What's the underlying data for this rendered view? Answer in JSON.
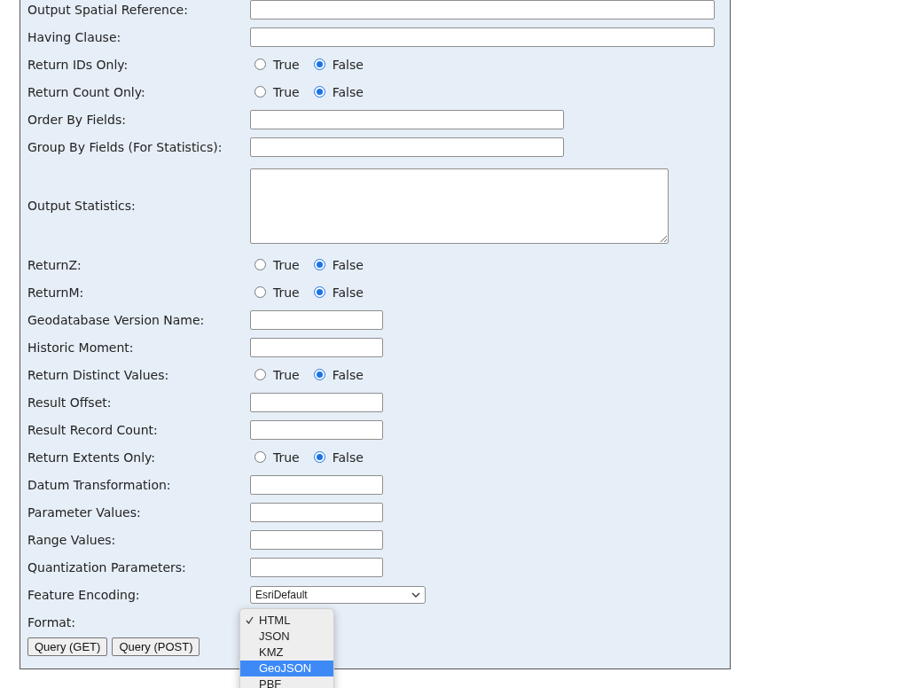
{
  "rows": [
    {
      "label": "Output Spatial Reference:",
      "kind": "text"
    },
    {
      "label": "Having Clause:",
      "kind": "text"
    },
    {
      "label": "Return IDs Only:",
      "kind": "radio",
      "options": [
        {
          "label": "True",
          "selected": false
        },
        {
          "label": "False",
          "selected": true
        }
      ]
    },
    {
      "label": "Return Count Only:",
      "kind": "radio",
      "options": [
        {
          "label": "True",
          "selected": false
        },
        {
          "label": "False",
          "selected": true
        }
      ]
    },
    {
      "label": "Order By Fields:",
      "kind": "text"
    },
    {
      "label": "Group By Fields (For Statistics):",
      "kind": "text"
    },
    {
      "label": "Output Statistics:",
      "kind": "textarea"
    },
    {
      "label": "ReturnZ:",
      "kind": "radio",
      "options": [
        {
          "label": "True",
          "selected": false
        },
        {
          "label": "False",
          "selected": true
        }
      ]
    },
    {
      "label": "ReturnM:",
      "kind": "radio",
      "options": [
        {
          "label": "True",
          "selected": false
        },
        {
          "label": "False",
          "selected": true
        }
      ]
    },
    {
      "label": "Geodatabase Version Name:",
      "kind": "text"
    },
    {
      "label": "Historic Moment:",
      "kind": "text"
    },
    {
      "label": "Return Distinct Values:",
      "kind": "radio",
      "options": [
        {
          "label": "True",
          "selected": false
        },
        {
          "label": "False",
          "selected": true
        }
      ]
    },
    {
      "label": "Result Offset:",
      "kind": "text"
    },
    {
      "label": "Result Record Count:",
      "kind": "text"
    },
    {
      "label": "Return Extents Only:",
      "kind": "radio",
      "options": [
        {
          "label": "True",
          "selected": false
        },
        {
          "label": "False",
          "selected": true
        }
      ]
    },
    {
      "label": "Datum Transformation:",
      "kind": "text"
    },
    {
      "label": "Parameter Values:",
      "kind": "text"
    },
    {
      "label": "Range Values:",
      "kind": "text"
    },
    {
      "label": "Quantization Parameters:",
      "kind": "text"
    },
    {
      "label": "Feature Encoding:",
      "kind": "select",
      "value": "EsriDefault"
    },
    {
      "label": "Format:",
      "kind": "dropdown",
      "options": [
        {
          "label": "HTML",
          "selected": true,
          "highlighted": false
        },
        {
          "label": "JSON",
          "selected": false,
          "highlighted": false
        },
        {
          "label": "KMZ",
          "selected": false,
          "highlighted": false
        },
        {
          "label": "GeoJSON",
          "selected": false,
          "highlighted": true
        },
        {
          "label": "PBF",
          "selected": false,
          "highlighted": false
        }
      ]
    }
  ],
  "buttons": [
    "Query (GET)",
    "Query (POST)"
  ]
}
